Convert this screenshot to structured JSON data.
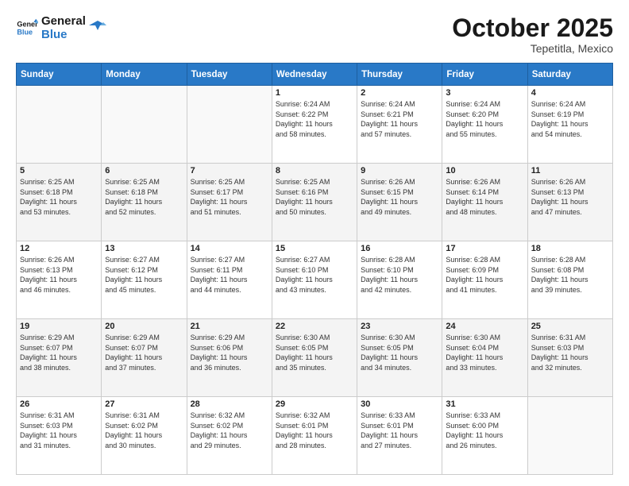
{
  "header": {
    "logo_line1": "General",
    "logo_line2": "Blue",
    "month": "October 2025",
    "location": "Tepetitla, Mexico"
  },
  "days_of_week": [
    "Sunday",
    "Monday",
    "Tuesday",
    "Wednesday",
    "Thursday",
    "Friday",
    "Saturday"
  ],
  "weeks": [
    [
      {
        "day": "",
        "info": ""
      },
      {
        "day": "",
        "info": ""
      },
      {
        "day": "",
        "info": ""
      },
      {
        "day": "1",
        "info": "Sunrise: 6:24 AM\nSunset: 6:22 PM\nDaylight: 11 hours\nand 58 minutes."
      },
      {
        "day": "2",
        "info": "Sunrise: 6:24 AM\nSunset: 6:21 PM\nDaylight: 11 hours\nand 57 minutes."
      },
      {
        "day": "3",
        "info": "Sunrise: 6:24 AM\nSunset: 6:20 PM\nDaylight: 11 hours\nand 55 minutes."
      },
      {
        "day": "4",
        "info": "Sunrise: 6:24 AM\nSunset: 6:19 PM\nDaylight: 11 hours\nand 54 minutes."
      }
    ],
    [
      {
        "day": "5",
        "info": "Sunrise: 6:25 AM\nSunset: 6:18 PM\nDaylight: 11 hours\nand 53 minutes."
      },
      {
        "day": "6",
        "info": "Sunrise: 6:25 AM\nSunset: 6:18 PM\nDaylight: 11 hours\nand 52 minutes."
      },
      {
        "day": "7",
        "info": "Sunrise: 6:25 AM\nSunset: 6:17 PM\nDaylight: 11 hours\nand 51 minutes."
      },
      {
        "day": "8",
        "info": "Sunrise: 6:25 AM\nSunset: 6:16 PM\nDaylight: 11 hours\nand 50 minutes."
      },
      {
        "day": "9",
        "info": "Sunrise: 6:26 AM\nSunset: 6:15 PM\nDaylight: 11 hours\nand 49 minutes."
      },
      {
        "day": "10",
        "info": "Sunrise: 6:26 AM\nSunset: 6:14 PM\nDaylight: 11 hours\nand 48 minutes."
      },
      {
        "day": "11",
        "info": "Sunrise: 6:26 AM\nSunset: 6:13 PM\nDaylight: 11 hours\nand 47 minutes."
      }
    ],
    [
      {
        "day": "12",
        "info": "Sunrise: 6:26 AM\nSunset: 6:13 PM\nDaylight: 11 hours\nand 46 minutes."
      },
      {
        "day": "13",
        "info": "Sunrise: 6:27 AM\nSunset: 6:12 PM\nDaylight: 11 hours\nand 45 minutes."
      },
      {
        "day": "14",
        "info": "Sunrise: 6:27 AM\nSunset: 6:11 PM\nDaylight: 11 hours\nand 44 minutes."
      },
      {
        "day": "15",
        "info": "Sunrise: 6:27 AM\nSunset: 6:10 PM\nDaylight: 11 hours\nand 43 minutes."
      },
      {
        "day": "16",
        "info": "Sunrise: 6:28 AM\nSunset: 6:10 PM\nDaylight: 11 hours\nand 42 minutes."
      },
      {
        "day": "17",
        "info": "Sunrise: 6:28 AM\nSunset: 6:09 PM\nDaylight: 11 hours\nand 41 minutes."
      },
      {
        "day": "18",
        "info": "Sunrise: 6:28 AM\nSunset: 6:08 PM\nDaylight: 11 hours\nand 39 minutes."
      }
    ],
    [
      {
        "day": "19",
        "info": "Sunrise: 6:29 AM\nSunset: 6:07 PM\nDaylight: 11 hours\nand 38 minutes."
      },
      {
        "day": "20",
        "info": "Sunrise: 6:29 AM\nSunset: 6:07 PM\nDaylight: 11 hours\nand 37 minutes."
      },
      {
        "day": "21",
        "info": "Sunrise: 6:29 AM\nSunset: 6:06 PM\nDaylight: 11 hours\nand 36 minutes."
      },
      {
        "day": "22",
        "info": "Sunrise: 6:30 AM\nSunset: 6:05 PM\nDaylight: 11 hours\nand 35 minutes."
      },
      {
        "day": "23",
        "info": "Sunrise: 6:30 AM\nSunset: 6:05 PM\nDaylight: 11 hours\nand 34 minutes."
      },
      {
        "day": "24",
        "info": "Sunrise: 6:30 AM\nSunset: 6:04 PM\nDaylight: 11 hours\nand 33 minutes."
      },
      {
        "day": "25",
        "info": "Sunrise: 6:31 AM\nSunset: 6:03 PM\nDaylight: 11 hours\nand 32 minutes."
      }
    ],
    [
      {
        "day": "26",
        "info": "Sunrise: 6:31 AM\nSunset: 6:03 PM\nDaylight: 11 hours\nand 31 minutes."
      },
      {
        "day": "27",
        "info": "Sunrise: 6:31 AM\nSunset: 6:02 PM\nDaylight: 11 hours\nand 30 minutes."
      },
      {
        "day": "28",
        "info": "Sunrise: 6:32 AM\nSunset: 6:02 PM\nDaylight: 11 hours\nand 29 minutes."
      },
      {
        "day": "29",
        "info": "Sunrise: 6:32 AM\nSunset: 6:01 PM\nDaylight: 11 hours\nand 28 minutes."
      },
      {
        "day": "30",
        "info": "Sunrise: 6:33 AM\nSunset: 6:01 PM\nDaylight: 11 hours\nand 27 minutes."
      },
      {
        "day": "31",
        "info": "Sunrise: 6:33 AM\nSunset: 6:00 PM\nDaylight: 11 hours\nand 26 minutes."
      },
      {
        "day": "",
        "info": ""
      }
    ]
  ]
}
